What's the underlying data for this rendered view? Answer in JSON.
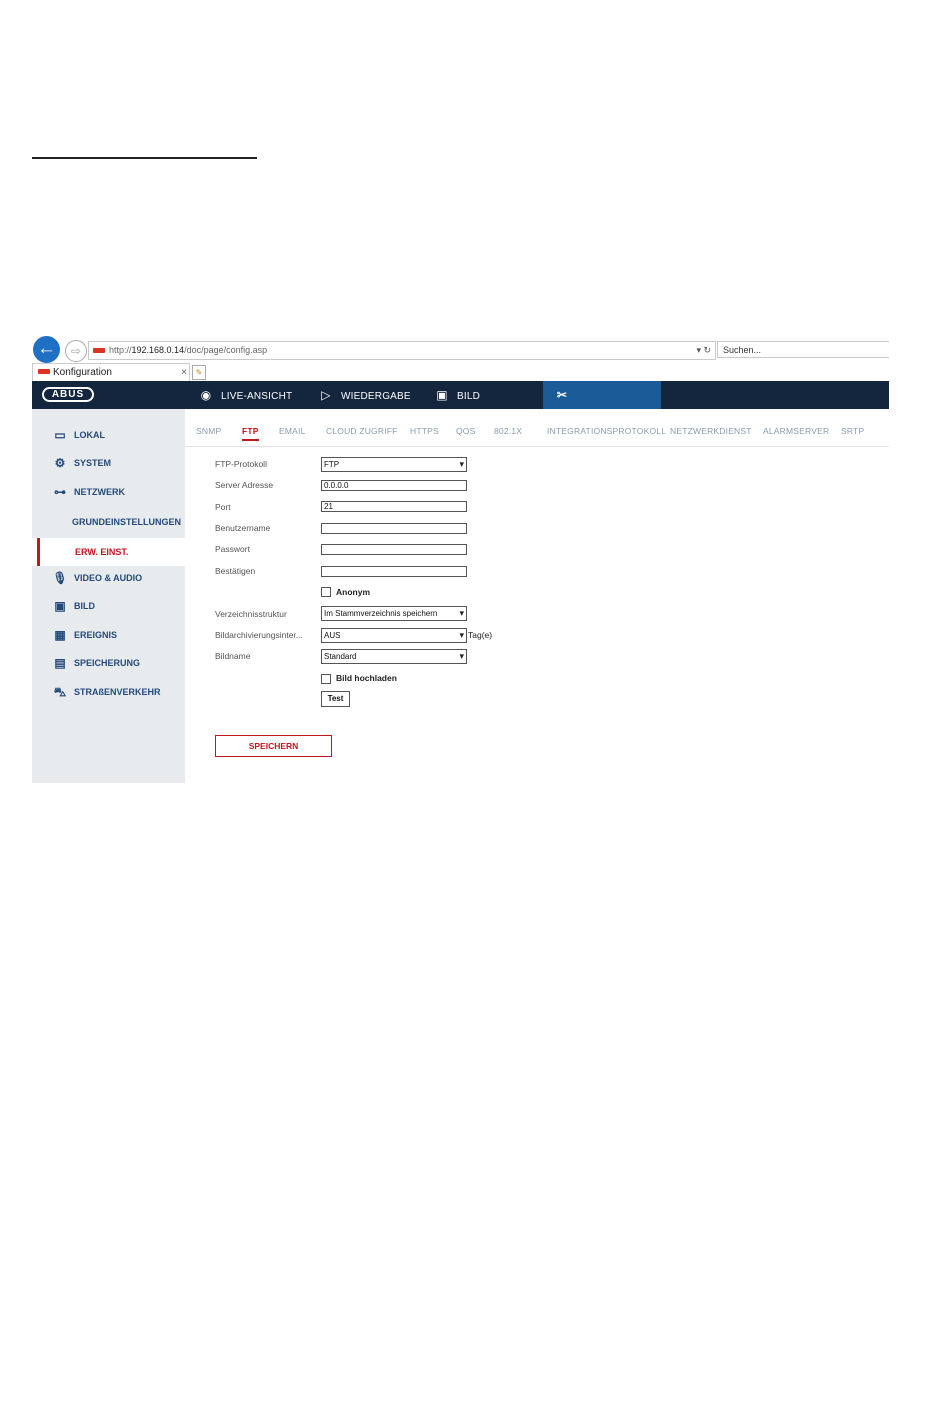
{
  "browser": {
    "url_prefix": "http://",
    "url_host": "192.168.0.14",
    "url_path": "/doc/page/config.asp",
    "url_tools": "▾ ↻",
    "search_placeholder": "Suchen...",
    "tab_title": "Konfiguration",
    "tab_close": "×"
  },
  "header": {
    "logo": "ABUS",
    "nav": [
      {
        "label": "LIVE-ANSICHT",
        "icon": "live-view-icon"
      },
      {
        "label": "WIEDERGABE",
        "icon": "play-icon"
      },
      {
        "label": "BILD",
        "icon": "image-icon"
      },
      {
        "label": "KONFIGURATION",
        "icon": "tools-icon",
        "active": true
      }
    ],
    "accent": "#1a5a96",
    "bar_color": "#14253e"
  },
  "sidebar": {
    "items": [
      {
        "label": "LOKAL",
        "icon": "monitor-icon"
      },
      {
        "label": "SYSTEM",
        "icon": "gear-icon"
      },
      {
        "label": "NETZWERK",
        "icon": "network-icon"
      },
      {
        "label": "GRUNDEINSTELLUNGEN",
        "sub": true
      },
      {
        "label": "ERW. EINST.",
        "sub": true,
        "active": true
      },
      {
        "label": "VIDEO & AUDIO",
        "icon": "microphone-icon"
      },
      {
        "label": "BILD",
        "icon": "image-icon"
      },
      {
        "label": "EREIGNIS",
        "icon": "calendar-icon"
      },
      {
        "label": "SPEICHERUNG",
        "icon": "storage-icon"
      },
      {
        "label": "STRAßENVERKEHR",
        "icon": "traffic-icon"
      }
    ]
  },
  "tabs": [
    "SNMP",
    "FTP",
    "EMAIL",
    "CLOUD ZUGRIFF",
    "HTTPS",
    "QOS",
    "802.1X",
    "INTEGRATIONSPROTOKOLL",
    "NETZWERKDIENST",
    "ALARMSERVER",
    "SRTP"
  ],
  "active_tab": "FTP",
  "form": {
    "protocol_label": "FTP-Protokoll",
    "protocol_value": "FTP",
    "server_label": "Server Adresse",
    "server_value": "0.0.0.0",
    "port_label": "Port",
    "port_value": "21",
    "user_label": "Benutzername",
    "user_value": "",
    "password_label": "Passwort",
    "password_value": "",
    "confirm_label": "Bestätigen",
    "confirm_value": "",
    "anonym_label": "Anonym",
    "dir_label": "Verzeichnisstruktur",
    "dir_value": "Im Stammverzeichnis speichern",
    "archive_label": "Bildarchivierungsinter...",
    "archive_value": "AUS",
    "archive_unit": "Tag(e)",
    "imagename_label": "Bildname",
    "imagename_value": "Standard",
    "upload_label": "Bild hochladen",
    "test_button": "Test",
    "save_button": "SPEICHERN"
  },
  "colors": {
    "active_red": "#c0161f",
    "sidebar_bg": "#e8ebee"
  }
}
